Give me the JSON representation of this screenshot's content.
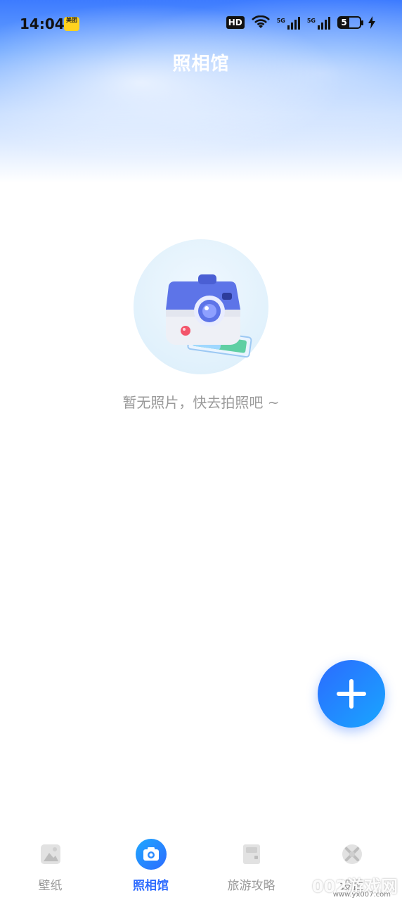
{
  "status_bar": {
    "time": "14:04",
    "app_badge": "美团",
    "hd": "HD",
    "signal_label_1": "5G",
    "signal_label_2": "5G",
    "battery": "5"
  },
  "header": {
    "title": "照相馆"
  },
  "empty_state": {
    "message": "暂无照片，快去拍照吧 ~"
  },
  "fab": {
    "icon": "plus-icon"
  },
  "tabs": [
    {
      "label": "壁纸",
      "icon": "wallpaper-icon",
      "active": false
    },
    {
      "label": "照相馆",
      "icon": "camera-icon",
      "active": true
    },
    {
      "label": "旅游攻略",
      "icon": "guide-book-icon",
      "active": false
    },
    {
      "label": "设置",
      "icon": "settings-icon",
      "active": false
    }
  ],
  "watermark": {
    "text": "002游戏网",
    "url": "www.yx007.com"
  },
  "colors": {
    "accent": "#2d6bff",
    "muted": "#9a9a9a",
    "header_top": "#3d7bff"
  }
}
